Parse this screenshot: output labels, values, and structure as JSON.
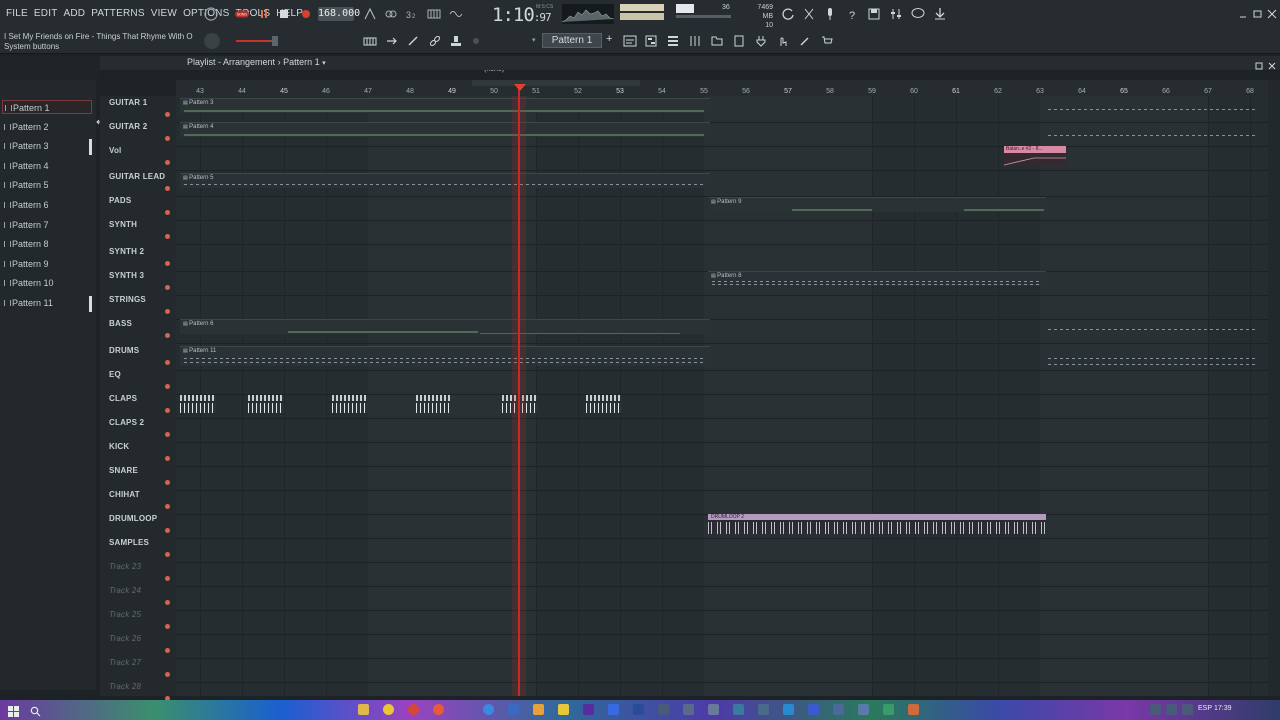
{
  "menu": [
    "FILE",
    "EDIT",
    "ADD",
    "PATTERNS",
    "VIEW",
    "OPTIONS",
    "TOOLS",
    "HELP"
  ],
  "hint": {
    "song": "I Set My Friends on Fire - Things That Rhyme With O",
    "sub": "System buttons"
  },
  "transport": {
    "mode": "SONG",
    "tempo": "168.000",
    "time": "1:10",
    "time_sub": "97",
    "bst": "M:S:CS"
  },
  "memory": {
    "mb": "7469 MB",
    "voices": "10",
    "cpu": "36"
  },
  "pattern_selector": "Pattern 1",
  "none_selector": "(none)",
  "playlist": {
    "title": "Playlist - Arrangement",
    "sep": "›",
    "pattern": "Pattern 1"
  },
  "patterns": [
    "Pattern 1",
    "Pattern 2",
    "Pattern 3",
    "Pattern 4",
    "Pattern 5",
    "Pattern 6",
    "Pattern 7",
    "Pattern 8",
    "Pattern 9",
    "Pattern 10",
    "Pattern 11"
  ],
  "bar_numbers": [
    "43",
    "44",
    "45",
    "46",
    "47",
    "48",
    "49",
    "50",
    "51",
    "52",
    "53",
    "54",
    "55",
    "56",
    "57",
    "58",
    "59",
    "60",
    "61",
    "62",
    "63",
    "64",
    "65",
    "66",
    "67",
    "68"
  ],
  "tracks": [
    "GUITAR 1",
    "GUITAR 2",
    "Vol",
    "GUITAR LEAD",
    "PADS",
    "SYNTH",
    "SYNTH 2",
    "SYNTH 3",
    "STRINGS",
    "BASS",
    "DRUMS",
    "EQ",
    "CLAPS",
    "CLAPS 2",
    "KICK",
    "SNARE",
    "CHIHAT",
    "DRUMLOOP",
    "SAMPLES",
    "Track 23",
    "Track 24",
    "Track 25",
    "Track 26",
    "Track 27",
    "Track 28"
  ],
  "clips": {
    "guitar1": "Pattern 3",
    "guitar2": "Pattern 4",
    "guitar_lead": "Pattern 5",
    "pads": "Pattern 9",
    "synth3": "Pattern 8",
    "bass": "Pattern 6",
    "drums": "Pattern 11",
    "drumloop": "DRUMLOOP 2",
    "automation": "Balan..e #2 - 8..."
  },
  "taskbar": {
    "lang": "ESP",
    "clock": "17:39"
  },
  "colors": {
    "playhead": "#c42a26",
    "accent": "#d6644f",
    "drumloop": "#b59ac0",
    "automation": "#d889a4"
  }
}
